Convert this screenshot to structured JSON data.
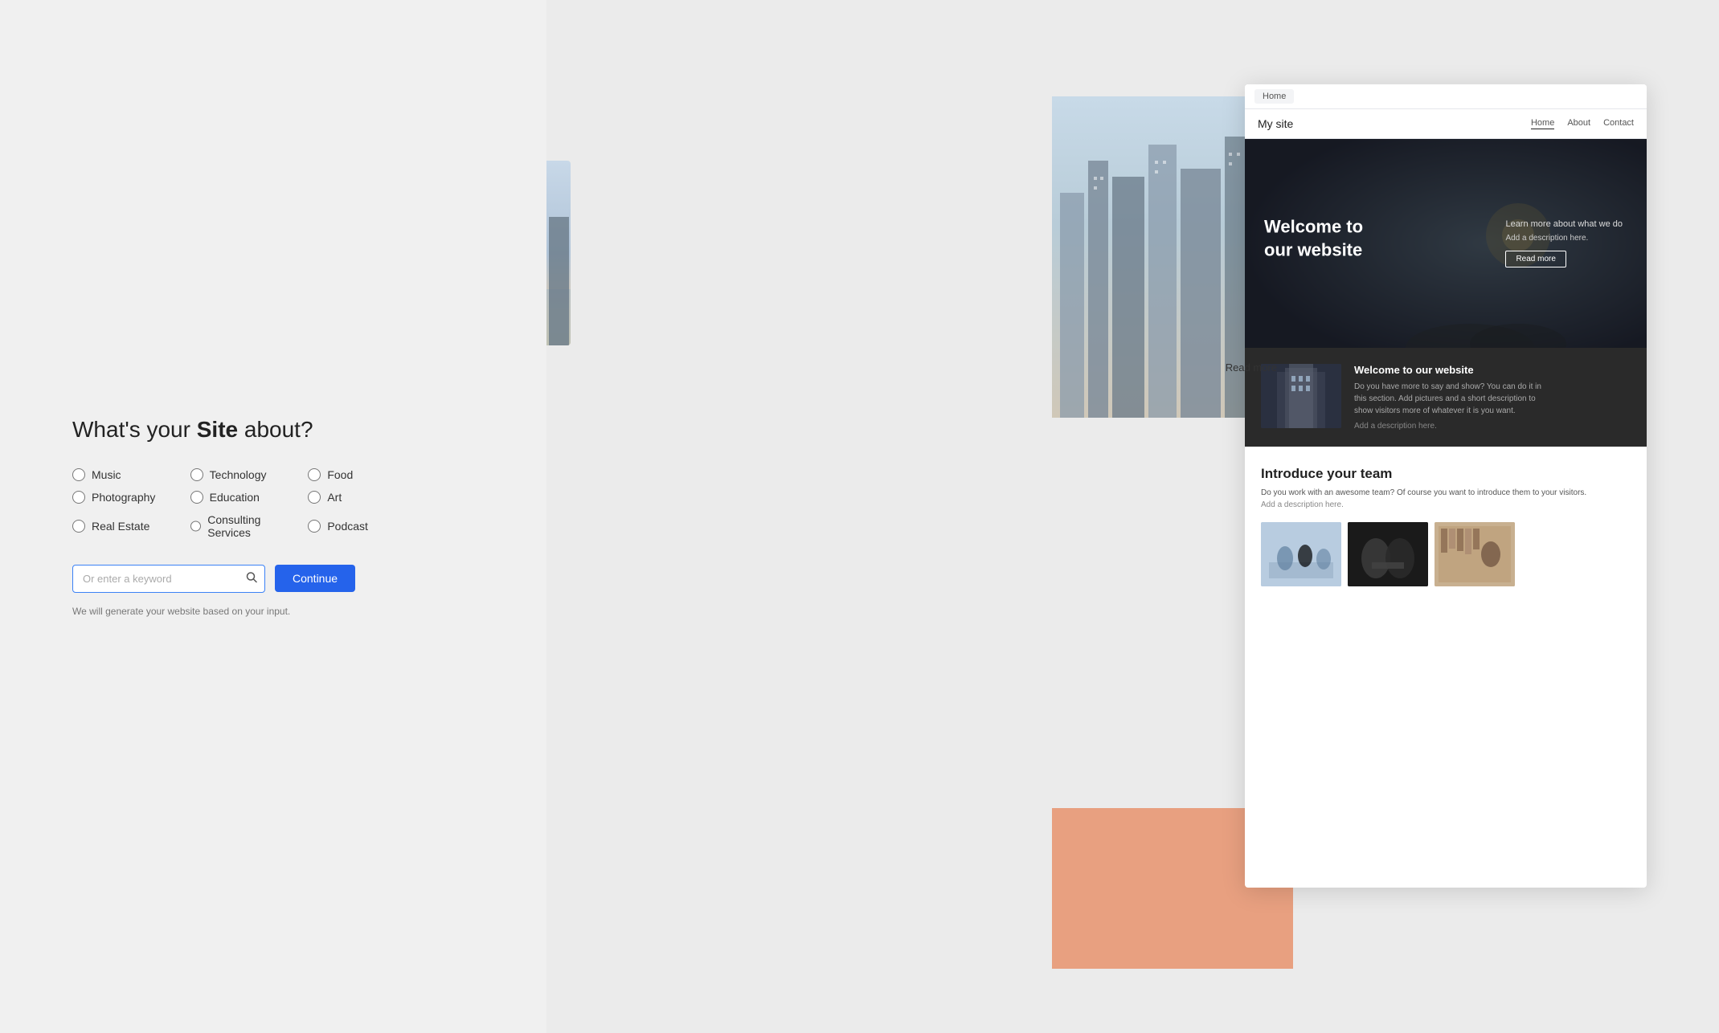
{
  "page": {
    "background_color": "#f0f0f0"
  },
  "site_builder": {
    "question": {
      "prefix": "What's your ",
      "highlight": "Site",
      "suffix": " about?"
    },
    "options": [
      {
        "id": "music",
        "label": "Music",
        "column": 1,
        "checked": false
      },
      {
        "id": "photography",
        "label": "Photography",
        "column": 1,
        "checked": false
      },
      {
        "id": "real_estate",
        "label": "Real Estate",
        "column": 1,
        "checked": false
      },
      {
        "id": "technology",
        "label": "Technology",
        "column": 2,
        "checked": false
      },
      {
        "id": "education",
        "label": "Education",
        "column": 2,
        "checked": false
      },
      {
        "id": "consulting",
        "label": "Consulting Services",
        "column": 2,
        "checked": false
      },
      {
        "id": "food",
        "label": "Food",
        "column": 3,
        "checked": false
      },
      {
        "id": "art",
        "label": "Art",
        "column": 3,
        "checked": false
      },
      {
        "id": "podcast",
        "label": "Podcast",
        "column": 3,
        "checked": false
      }
    ],
    "search_placeholder": "Or enter a keyword",
    "continue_button": "Continue",
    "helper_text": "We will generate your website based on your input."
  },
  "preview": {
    "browser_tab": "Home",
    "site_name": "My site",
    "nav_links": [
      {
        "label": "Home",
        "active": true
      },
      {
        "label": "About",
        "active": false
      },
      {
        "label": "Contact",
        "active": false
      }
    ],
    "hero": {
      "title": "Welcome to\nour website",
      "right_title": "Learn more about what we do",
      "right_desc": "Add a description here.",
      "button_label": "Read more"
    },
    "dark_section": {
      "title": "Welcome to our website",
      "body": "Do you have more to say and show? You can do it in\nthis section. Add pictures and a short description to\nshow visitors more of whatever it is you want.",
      "add_text": "Add a description here."
    },
    "team_section": {
      "title": "Introduce your team",
      "desc": "Do you work with an awesome team? Of course you want to introduce them to your visitors.",
      "add_text": "Add a description here."
    }
  },
  "deco": {
    "read_more": "Read more"
  }
}
